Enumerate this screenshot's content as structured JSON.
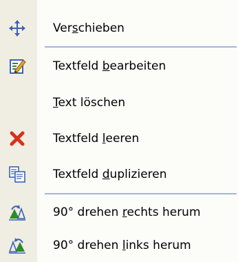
{
  "menu": {
    "items": [
      {
        "pre": "Ver",
        "acc": "s",
        "post": "chieben",
        "icon": "move-arrows-icon"
      },
      {
        "pre": "Textfeld ",
        "acc": "b",
        "post": "earbeiten",
        "icon": "edit-pencil-icon"
      },
      {
        "pre": "",
        "acc": "T",
        "post": "ext löschen",
        "icon": ""
      },
      {
        "pre": "Textfeld ",
        "acc": "l",
        "post": "eeren",
        "icon": "red-x-icon"
      },
      {
        "pre": "Textfeld ",
        "acc": "d",
        "post": "uplizieren",
        "icon": "duplicate-icon"
      },
      {
        "pre": "90° drehen ",
        "acc": "r",
        "post": "echts herum",
        "icon": "rotate-right-icon"
      },
      {
        "pre": "90° drehen ",
        "acc": "l",
        "post": "inks herum",
        "icon": "rotate-left-icon"
      }
    ]
  },
  "colors": {
    "gutter": "#f0ede2",
    "separator": "#a4b5d6",
    "icon_blue": "#3b62b8",
    "icon_green": "#2d8a2d",
    "icon_red": "#d8321c"
  }
}
